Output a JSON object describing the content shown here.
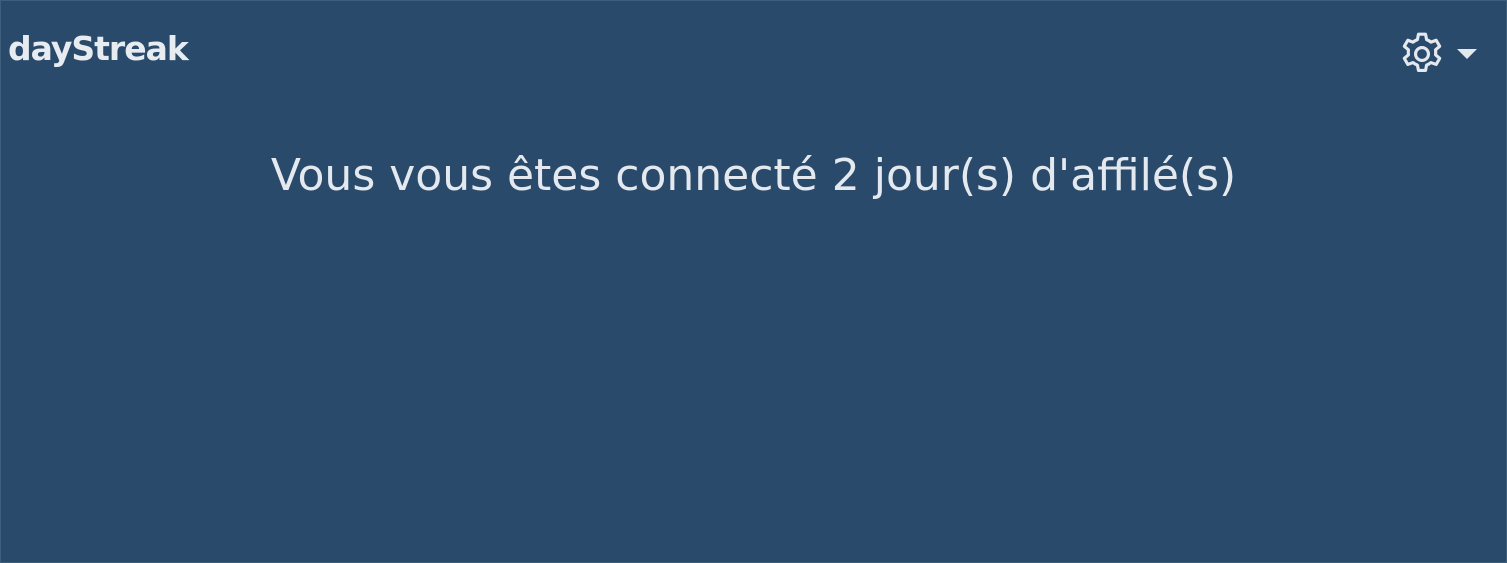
{
  "widget": {
    "title": "dayStreak",
    "message": "Vous vous êtes connecté 2 jour(s) d'affilé(s)",
    "settings_icon": "gear-icon",
    "dropdown_icon": "chevron-down-icon"
  },
  "colors": {
    "background": "#2a4a6b",
    "text": "#e4e9ef"
  }
}
